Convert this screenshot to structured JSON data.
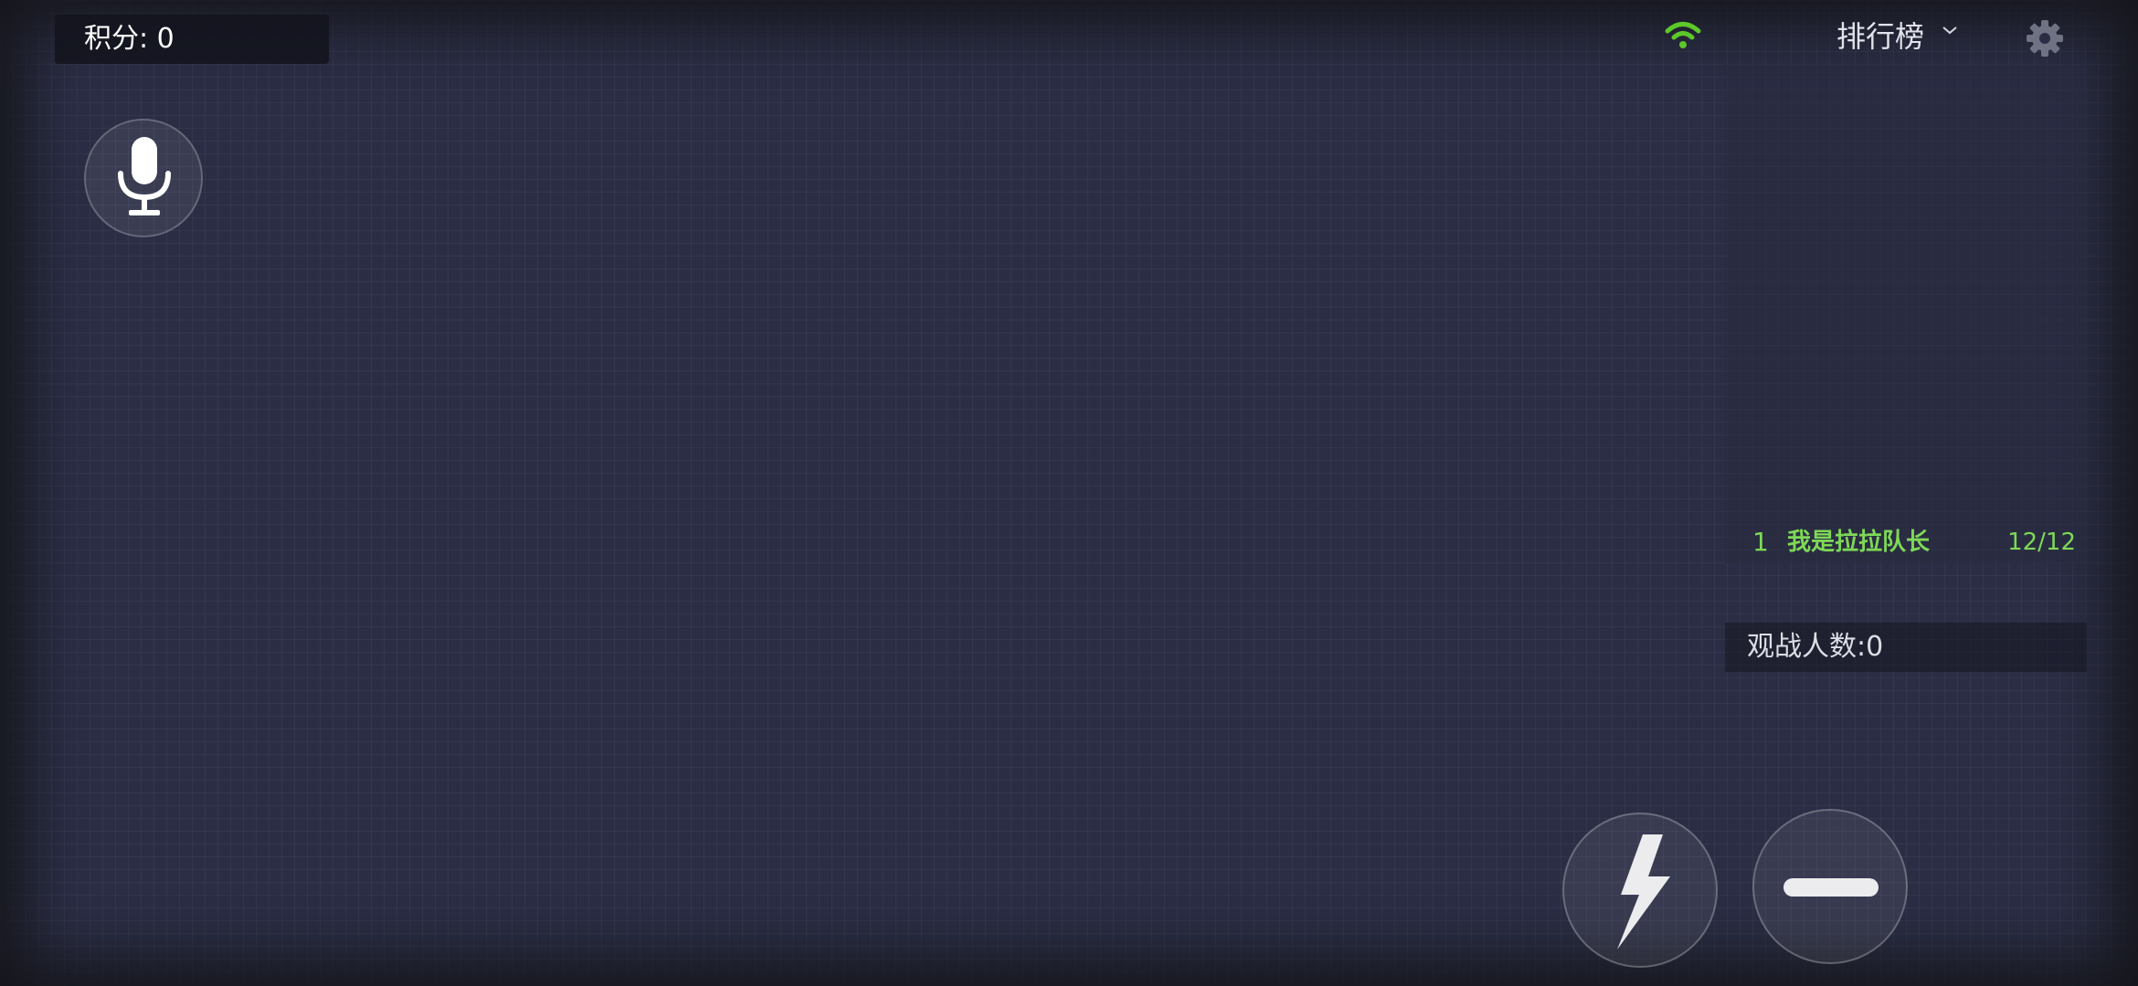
{
  "hud": {
    "score_label": "积分: 0",
    "leaderboard_title": "排行榜",
    "spectators_label": "观战人数:0"
  },
  "icons": {
    "mic": "microphone-icon",
    "wifi": "wifi-icon",
    "chevron": "chevron-down-icon",
    "settings": "gear-icon",
    "boost": "lightning-icon",
    "shrink": "minus-icon"
  },
  "leaderboard": {
    "entries": [
      {
        "rank": "1",
        "name": "我是拉拉队长",
        "score": "12/12"
      }
    ]
  },
  "colors": {
    "background": "#2a2d44",
    "leader_green": "#7ed957",
    "wifi_green": "#5ec72a"
  }
}
